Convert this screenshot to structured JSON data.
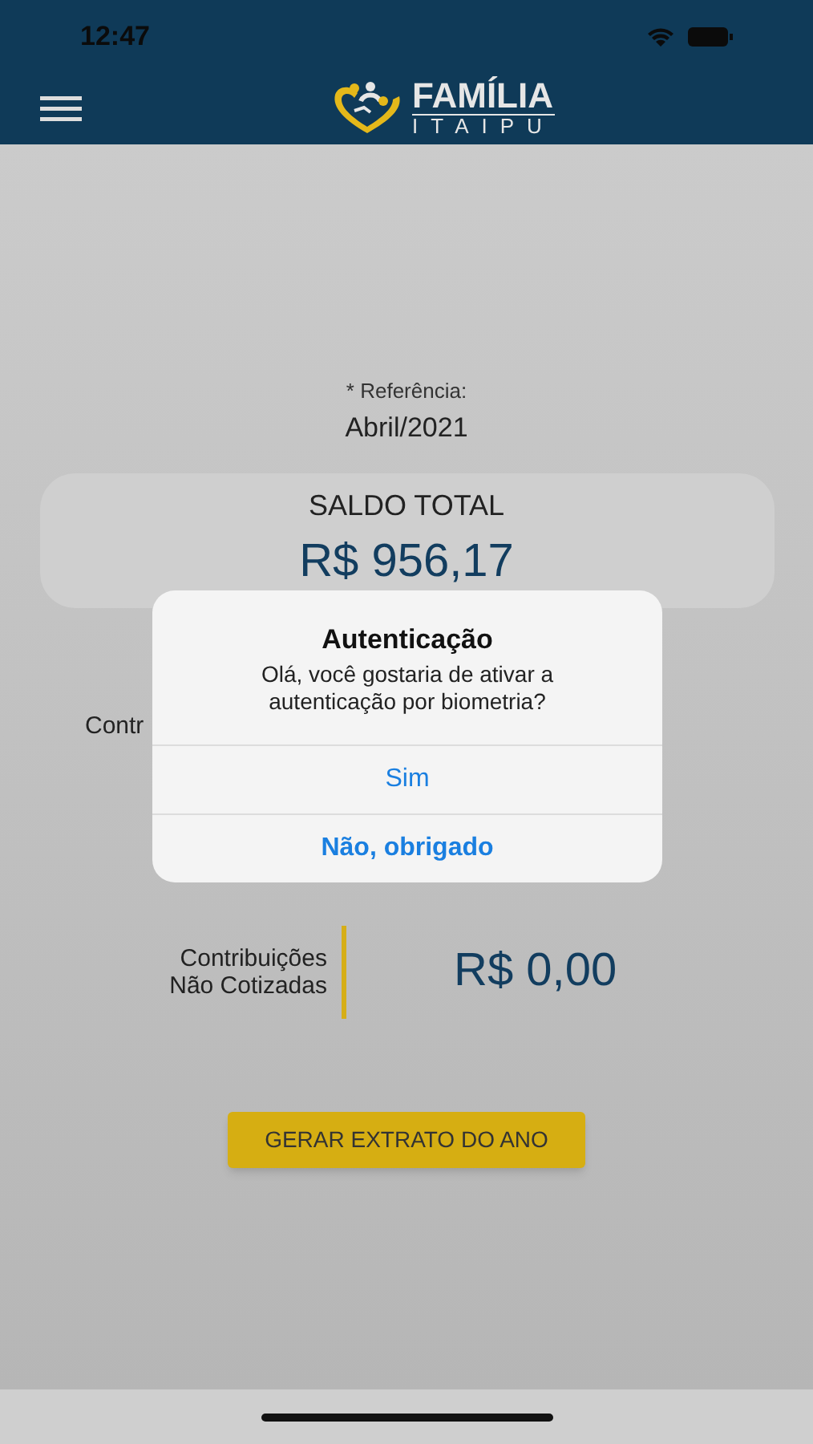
{
  "status_bar": {
    "time": "12:47"
  },
  "header": {
    "logo": {
      "line_1": "FAMÍLIA",
      "line_2": "ITAIPU"
    }
  },
  "reference": {
    "label": "* Referência:",
    "value": "Abril/2021"
  },
  "balance": {
    "label": "SALDO TOTAL",
    "value": "R$ 956,17"
  },
  "rows": [
    {
      "label": "Contr"
    },
    {
      "label": "Contribuições Não Cotizadas",
      "value": "R$ 0,00"
    }
  ],
  "action_button": "GERAR EXTRATO DO ANO",
  "dialog": {
    "title": "Autenticação",
    "message": "Olá, você gostaria de ativar a autenticação por biometria?",
    "buttons": [
      {
        "label": "Sim",
        "kind": "normal"
      },
      {
        "label": "Não, obrigado",
        "kind": "preferred"
      }
    ]
  }
}
